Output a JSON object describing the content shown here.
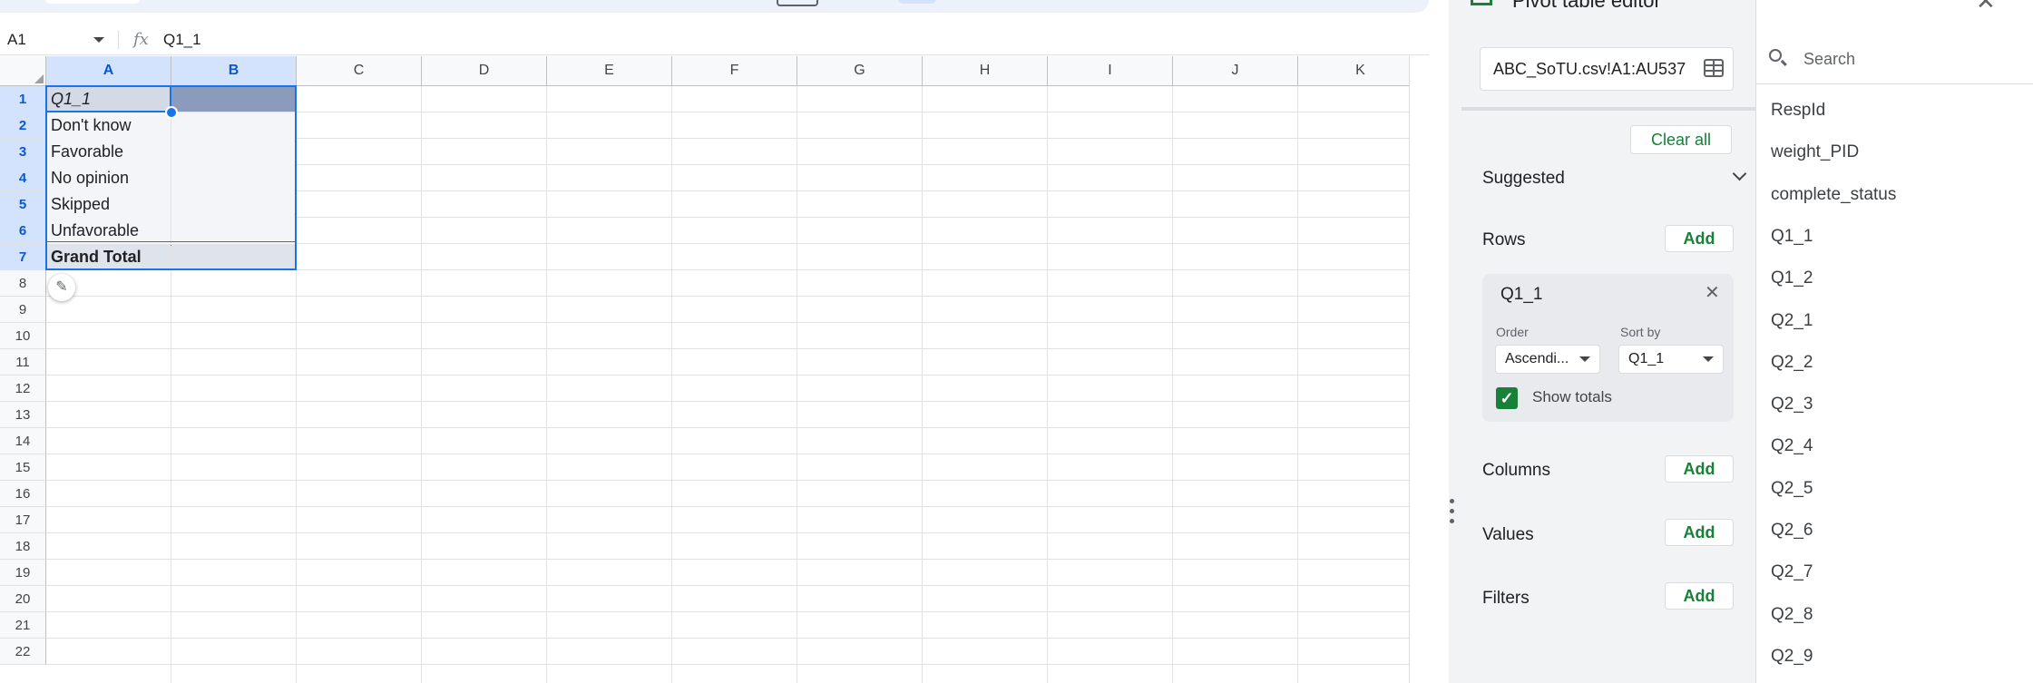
{
  "formula_bar": {
    "name_box": "A1",
    "formula": "Q1_1",
    "fx_symbol": "fx"
  },
  "columns": [
    "A",
    "B",
    "C",
    "D",
    "E",
    "F",
    "G",
    "H",
    "I",
    "J",
    "K"
  ],
  "rows": [
    "1",
    "2",
    "3",
    "4",
    "5",
    "6",
    "7",
    "8",
    "9",
    "10",
    "11",
    "12",
    "13",
    "14",
    "15",
    "16",
    "17",
    "18",
    "19",
    "20",
    "21",
    "22"
  ],
  "cells": {
    "a1": "Q1_1",
    "a2": "Don't know",
    "a3": "Favorable",
    "a4": "No opinion",
    "a5": "Skipped",
    "a6": "Unfavorable",
    "a7": "Grand Total"
  },
  "panel": {
    "title": "Pivot table editor",
    "range": "ABC_SoTU.csv!A1:AU537",
    "clear_all": "Clear all",
    "suggested": "Suggested",
    "rows_label": "Rows",
    "columns_label": "Columns",
    "values_label": "Values",
    "filters_label": "Filters",
    "add": "Add",
    "row_card": {
      "field": "Q1_1",
      "order_label": "Order",
      "order_value": "Ascendi...",
      "sort_label": "Sort by",
      "sort_value": "Q1_1",
      "show_totals": "Show totals",
      "show_totals_checked": true
    },
    "search_placeholder": "Search",
    "fields": [
      "RespId",
      "weight_PID",
      "complete_status",
      "Q1_1",
      "Q1_2",
      "Q2_1",
      "Q2_2",
      "Q2_3",
      "Q2_4",
      "Q2_5",
      "Q2_6",
      "Q2_7",
      "Q2_8",
      "Q2_9"
    ]
  },
  "colors": {
    "accent": "#188038",
    "selection": "#1a73e8"
  }
}
